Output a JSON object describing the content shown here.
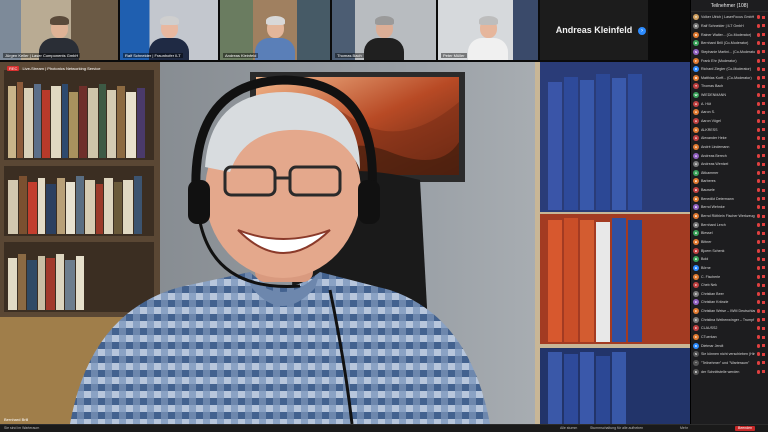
{
  "gallery": {
    "tiles": [
      {
        "caption": "Jürgen Keller | Laser Components GmbH",
        "bg": "#9a8a74",
        "shirt": "#2a2e36",
        "skin": "#dfb396",
        "hair": "#5a4a3a"
      },
      {
        "caption": "Ralf Schneider | Fraunhofer ILT",
        "bg": "#5e6a7a",
        "shirt": "#1f2a44",
        "skin": "#e8b8a0",
        "hair": "#cfcfcf"
      },
      {
        "caption": "Andreas Kleinfeld",
        "bg": "#6a7c60",
        "shirt": "#5a7fb8",
        "skin": "#e3b69a",
        "hair": "#d8d8d8"
      },
      {
        "caption": "Thomas Bach",
        "bg": "#aeb2b6",
        "shirt": "#202020",
        "skin": "#dcae96",
        "hair": "#9a9a9a"
      },
      {
        "caption": "Peter Müller",
        "bg": "#c9cdd1",
        "shirt": "#f0f0f0",
        "skin": "#e6b69c",
        "hair": "#bdbdbd"
      }
    ],
    "name_tile": "Andreas Kleinfeld",
    "next_icon": "chevron-right-icon"
  },
  "main": {
    "rec_label": "REC",
    "rec_status": "Live-Stream | Photonics Networking Service",
    "speaker": "Bernhard Brill"
  },
  "panel": {
    "title": "Teilnehmer (108)",
    "participants": [
      {
        "name": "Volker Ulrich | LaserFocus GmbH",
        "color": "#d0a060"
      },
      {
        "name": "Ralf Schneider | ILT GmbH",
        "color": "#7a7a7a"
      },
      {
        "name": "Rainer Walter... (Co-Moderator)",
        "color": "#e07a30"
      },
      {
        "name": "Bernhard Brill (Co-Moderator)",
        "color": "#3aa35a"
      },
      {
        "name": "Stephanie Martini... (Co-Moderator)",
        "color": "#9060c0"
      },
      {
        "name": "Frank Ehr (Moderator)",
        "color": "#e07a30"
      },
      {
        "name": "Richard Ziegler (Co-Moderator)",
        "color": "#2d8cff"
      },
      {
        "name": "Matthias Korff... (Co-Moderator)",
        "color": "#e07a30"
      },
      {
        "name": "Thomas Bach",
        "color": "#c04040"
      },
      {
        "name": "WIEDENMANN",
        "color": "#3aa35a"
      },
      {
        "name": "A. Hüt",
        "color": "#c04040"
      },
      {
        "name": "Aaron S.",
        "color": "#e07a30"
      },
      {
        "name": "Aaron Vögel",
        "color": "#c04040"
      },
      {
        "name": "ALKRESS",
        "color": "#e07a30"
      },
      {
        "name": "Alexander Heke",
        "color": "#c04040"
      },
      {
        "name": "André Lindemann",
        "color": "#e07a30"
      },
      {
        "name": "Andreas Berech",
        "color": "#9060c0"
      },
      {
        "name": "Andreas Wentzel",
        "color": "#7a7a7a"
      },
      {
        "name": "Ättkammer",
        "color": "#3aa35a"
      },
      {
        "name": "Barberes",
        "color": "#e07a30"
      },
      {
        "name": "Bauwele",
        "color": "#c04040"
      },
      {
        "name": "Benedikt Determann",
        "color": "#e07a30"
      },
      {
        "name": "Bernd Wehnke",
        "color": "#9060c0"
      },
      {
        "name": "Bernd Röthlein Fischer Werkzeug...",
        "color": "#e07a30"
      },
      {
        "name": "Bernhard Lerch",
        "color": "#7a7a7a"
      },
      {
        "name": "Blessel",
        "color": "#3aa35a"
      },
      {
        "name": "Bittner",
        "color": "#e07a30"
      },
      {
        "name": "Bjoern Schenk",
        "color": "#c04040"
      },
      {
        "name": "Bold",
        "color": "#3aa35a"
      },
      {
        "name": "Börne",
        "color": "#2d8cff"
      },
      {
        "name": "C. Fischerle",
        "color": "#e07a30"
      },
      {
        "name": "Cheb Nek",
        "color": "#c04040"
      },
      {
        "name": "Christian Beer",
        "color": "#7a7a7a"
      },
      {
        "name": "Christian Kränzle",
        "color": "#9060c0"
      },
      {
        "name": "Christian Weise – IWM Deutschland",
        "color": "#e07a30"
      },
      {
        "name": "Christina Weihenwinger – Trumpf",
        "color": "#7a7a7a"
      },
      {
        "name": "CLAUSS2",
        "color": "#c04040"
      },
      {
        "name": "CTuerkan",
        "color": "#e07a30"
      },
      {
        "name": "Dietmar Jendt",
        "color": "#2d8cff"
      },
      {
        "name": "Sie können nicht verschieben (Hinweis)",
        "color": "#555555"
      },
      {
        "name": "\"Teilnehmer\" und \"Warteraum\"",
        "color": "#555555"
      },
      {
        "name": "der Schnittstelle werden",
        "color": "#555555"
      }
    ]
  },
  "footer": {
    "left": "Sie sind im Warteraum",
    "actions": [
      "Alle stumm",
      "Stummschaltung für alle aufheben",
      "Mehr"
    ],
    "leave": "Beenden"
  }
}
